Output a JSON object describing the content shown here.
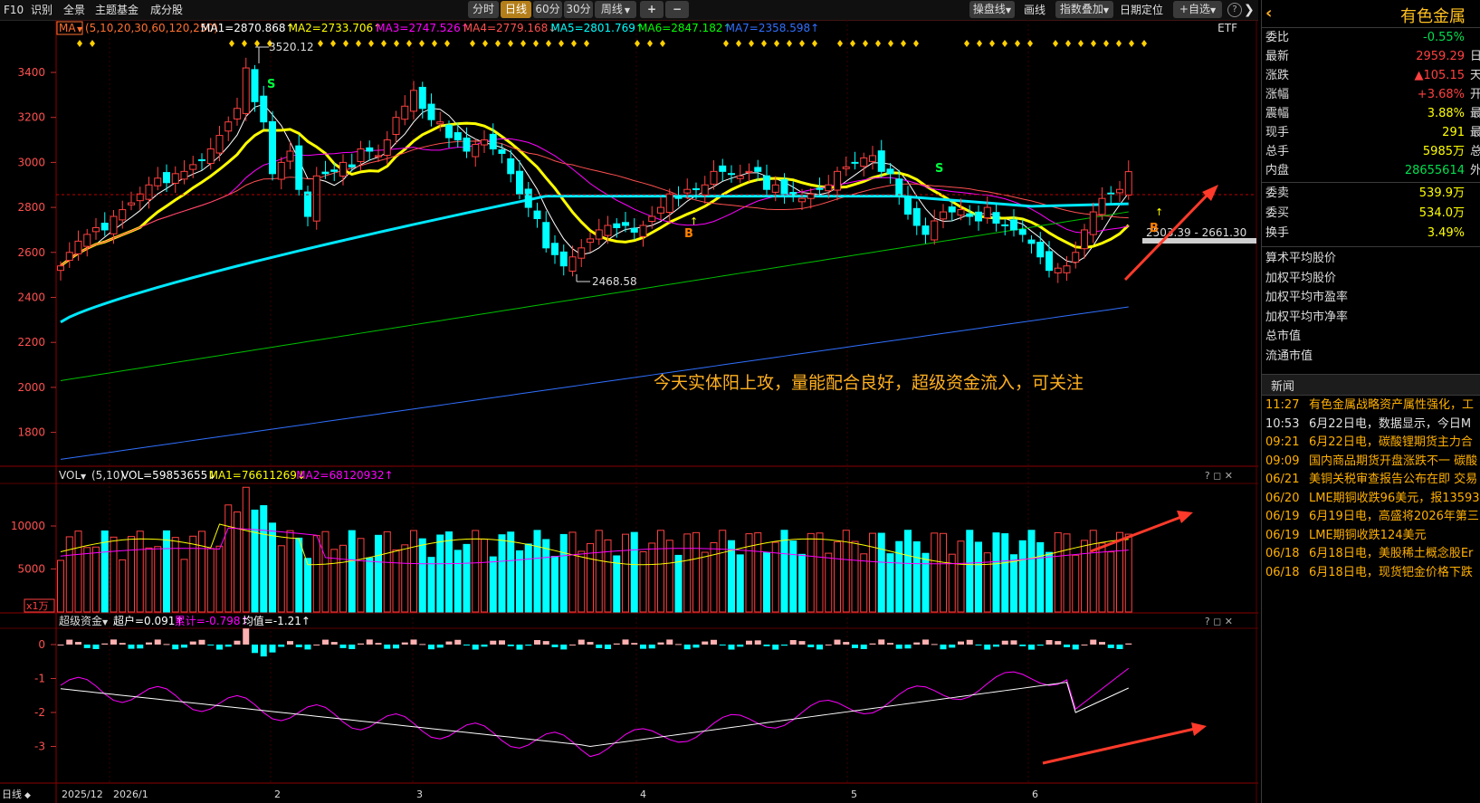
{
  "toolbar": {
    "left_items": [
      "F10",
      "识别",
      "全景",
      "主题基金",
      "成分股"
    ],
    "periods": [
      "分时",
      "日线",
      "60分",
      "30分",
      "周线"
    ],
    "active_period": "日线",
    "right_items": [
      "操盘线",
      "画线",
      "指数叠加",
      "日期定位",
      "自选"
    ]
  },
  "main_chart": {
    "indicator_name": "MA",
    "params": "(5,10,20,30,60,120,250)",
    "ma_values": [
      {
        "text": "MA1=2870.868↑",
        "color": "#ffffff"
      },
      {
        "text": "MA2=2733.706↑",
        "color": "#ffff00"
      },
      {
        "text": "MA3=2747.526↑",
        "color": "#ff00ff"
      },
      {
        "text": "MA4=2779.168↓",
        "color": "#ff5050"
      },
      {
        "text": "MA5=2801.769↑",
        "color": "#00ffff"
      },
      {
        "text": "MA6=2847.182↑",
        "color": "#00ff00"
      },
      {
        "text": "MA7=2358.598↑",
        "color": "#3070ff"
      }
    ],
    "right_tag": "ETF",
    "y_ticks": [
      3400,
      3200,
      3000,
      2800,
      2600,
      2400,
      2200,
      2000,
      1800
    ],
    "high_label": "3520.12",
    "low_label": "2468.58",
    "range_label": "2503.39 - 2661.30",
    "annotation": "今天实体阳上攻，量能配合良好，超级资金流入，可关注"
  },
  "volume_chart": {
    "indicator_name": "VOL",
    "params": "(5,10)",
    "values": [
      {
        "text": "VOL=59853655↓",
        "color": "#ffffff"
      },
      {
        "text": "MA1=76611269↓",
        "color": "#ffff00"
      },
      {
        "text": "MA2=68120932↑",
        "color": "#ff00ff"
      }
    ],
    "y_ticks": [
      10000,
      5000
    ],
    "unit_label": "x1万"
  },
  "fund_chart": {
    "indicator_name": "超级资金",
    "values": [
      {
        "text": "超户=0.091↑",
        "color": "#ffffff"
      },
      {
        "text": "累计=-0.798↑",
        "color": "#ff00ff"
      },
      {
        "text": "均值=-1.21↑",
        "color": "#ffffff"
      }
    ],
    "y_ticks": [
      0,
      -1,
      -2,
      -3
    ]
  },
  "x_axis": {
    "period_label": "日线",
    "labels": [
      "2025/12",
      "2026/1",
      "2",
      "3",
      "4",
      "5",
      "6"
    ]
  },
  "panel": {
    "title": "有色金属",
    "quote_rows": [
      {
        "label": "委比",
        "value": "-0.55%",
        "color": "#00e050",
        "suffix": ""
      },
      {
        "label": "最新",
        "value": "2959.29",
        "color": "#ff4040",
        "suffix": "日"
      },
      {
        "label": "涨跌",
        "value": "▲105.15",
        "color": "#ff4040",
        "suffix": "天"
      },
      {
        "label": "涨幅",
        "value": "+3.68%",
        "color": "#ff4040",
        "suffix": "开"
      },
      {
        "label": "震幅",
        "value": "3.88%",
        "color": "#ffff00",
        "suffix": "最"
      },
      {
        "label": "现手",
        "value": "291",
        "color": "#ffff00",
        "suffix": "最"
      },
      {
        "label": "总手",
        "value": "5985万",
        "color": "#ffff00",
        "suffix": "总"
      },
      {
        "label": "内盘",
        "value": "28655614",
        "color": "#00e050",
        "suffix": "外"
      }
    ],
    "order_rows": [
      {
        "label": "委卖",
        "value": "539.9万",
        "color": "#ffff00"
      },
      {
        "label": "委买",
        "value": "534.0万",
        "color": "#ffff00"
      },
      {
        "label": "换手",
        "value": "3.49%",
        "color": "#ffff00"
      }
    ],
    "info_rows": [
      "算术平均股价",
      "加权平均股价",
      "加权平均市盈率",
      "加权平均市净率",
      "总市值",
      "流通市值"
    ],
    "news_header": "新闻",
    "news": [
      {
        "time": "11:27",
        "title": "有色金属战略资产属性强化，工",
        "color": "#ffb000"
      },
      {
        "time": "10:53",
        "title": "6月22日电，数据显示，今日M",
        "color": "#e0e0e0"
      },
      {
        "time": "09:21",
        "title": "6月22日电，碳酸锂期货主力合",
        "color": "#ffb000"
      },
      {
        "time": "09:09",
        "title": "国内商品期货开盘涨跌不一 碳酸",
        "color": "#ffb000"
      },
      {
        "time": "06/21",
        "title": "美铜关税审查报告公布在即 交易",
        "color": "#ffb000"
      },
      {
        "time": "06/20",
        "title": "LME期铜收跌96美元，报13593",
        "color": "#ffb000"
      },
      {
        "time": "06/19",
        "title": "6月19日电，高盛将2026年第三",
        "color": "#ffb000"
      },
      {
        "time": "06/19",
        "title": "LME期铜收跌124美元",
        "color": "#ffb000"
      },
      {
        "time": "06/18",
        "title": "6月18日电，美股稀土概念股Er",
        "color": "#ffb000"
      },
      {
        "time": "06/18",
        "title": "6月18日电，现货钯金价格下跌",
        "color": "#ffb000"
      }
    ]
  }
}
